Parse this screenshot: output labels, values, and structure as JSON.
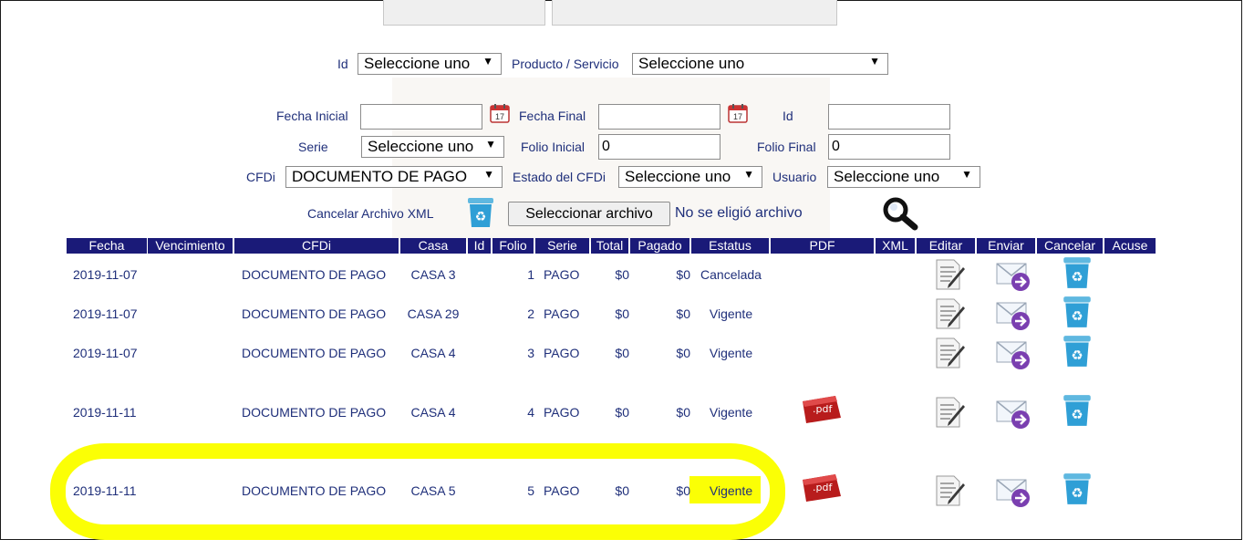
{
  "filters": {
    "id_label": "Id",
    "id_select": "Seleccione uno",
    "producto_label": "Producto / Servicio",
    "producto_select": "Seleccione uno",
    "fecha_inicial_label": "Fecha Inicial",
    "fecha_inicial_value": "",
    "fecha_final_label": "Fecha Final",
    "fecha_final_value": "",
    "id2_label": "Id",
    "id2_value": "",
    "serie_label": "Serie",
    "serie_select": "Seleccione uno",
    "folio_inicial_label": "Folio Inicial",
    "folio_inicial_value": "0",
    "folio_final_label": "Folio Final",
    "folio_final_value": "0",
    "cfdi_label": "CFDi",
    "cfdi_select": "DOCUMENTO DE PAGO",
    "estado_label": "Estado del CFDi",
    "estado_select": "Seleccione uno",
    "usuario_label": "Usuario",
    "usuario_select": "Seleccione uno",
    "cancelar_xml_label": "Cancelar Archivo XML",
    "file_button": "Seleccionar archivo",
    "no_file_text": "No se eligió archivo",
    "calendar_day": "17"
  },
  "table": {
    "headers": [
      "Fecha",
      "Vencimiento",
      "CFDi",
      "Casa",
      "Id",
      "Folio",
      "Serie",
      "Total",
      "Pagado",
      "Estatus",
      "PDF",
      "XML",
      "Editar",
      "Enviar",
      "Cancelar",
      "Acuse"
    ],
    "rows": [
      {
        "fecha": "2019-11-07",
        "cfdi": "DOCUMENTO DE PAGO",
        "casa": "CASA 3",
        "folio": "1",
        "serie": "PAGO",
        "total": "$0",
        "pagado": "$0",
        "estatus": "Cancelada",
        "pdf": false
      },
      {
        "fecha": "2019-11-07",
        "cfdi": "DOCUMENTO DE PAGO",
        "casa": "CASA 29",
        "folio": "2",
        "serie": "PAGO",
        "total": "$0",
        "pagado": "$0",
        "estatus": "Vigente",
        "pdf": false
      },
      {
        "fecha": "2019-11-07",
        "cfdi": "DOCUMENTO DE PAGO",
        "casa": "CASA 4",
        "folio": "3",
        "serie": "PAGO",
        "total": "$0",
        "pagado": "$0",
        "estatus": "Vigente",
        "pdf": false
      },
      {
        "fecha": "2019-11-11",
        "cfdi": "DOCUMENTO DE PAGO",
        "casa": "CASA 4",
        "folio": "4",
        "serie": "PAGO",
        "total": "$0",
        "pagado": "$0",
        "estatus": "Vigente",
        "pdf": true
      },
      {
        "fecha": "2019-11-11",
        "cfdi": "DOCUMENTO DE PAGO",
        "casa": "CASA 5",
        "folio": "5",
        "serie": "PAGO",
        "total": "$0",
        "pagado": "$0",
        "estatus": "Vigente",
        "pdf": true
      }
    ]
  },
  "icons": {
    "pdf_label": ".pdf",
    "header_bg": "#1a1a78",
    "highlight_color": "#fbff05"
  }
}
